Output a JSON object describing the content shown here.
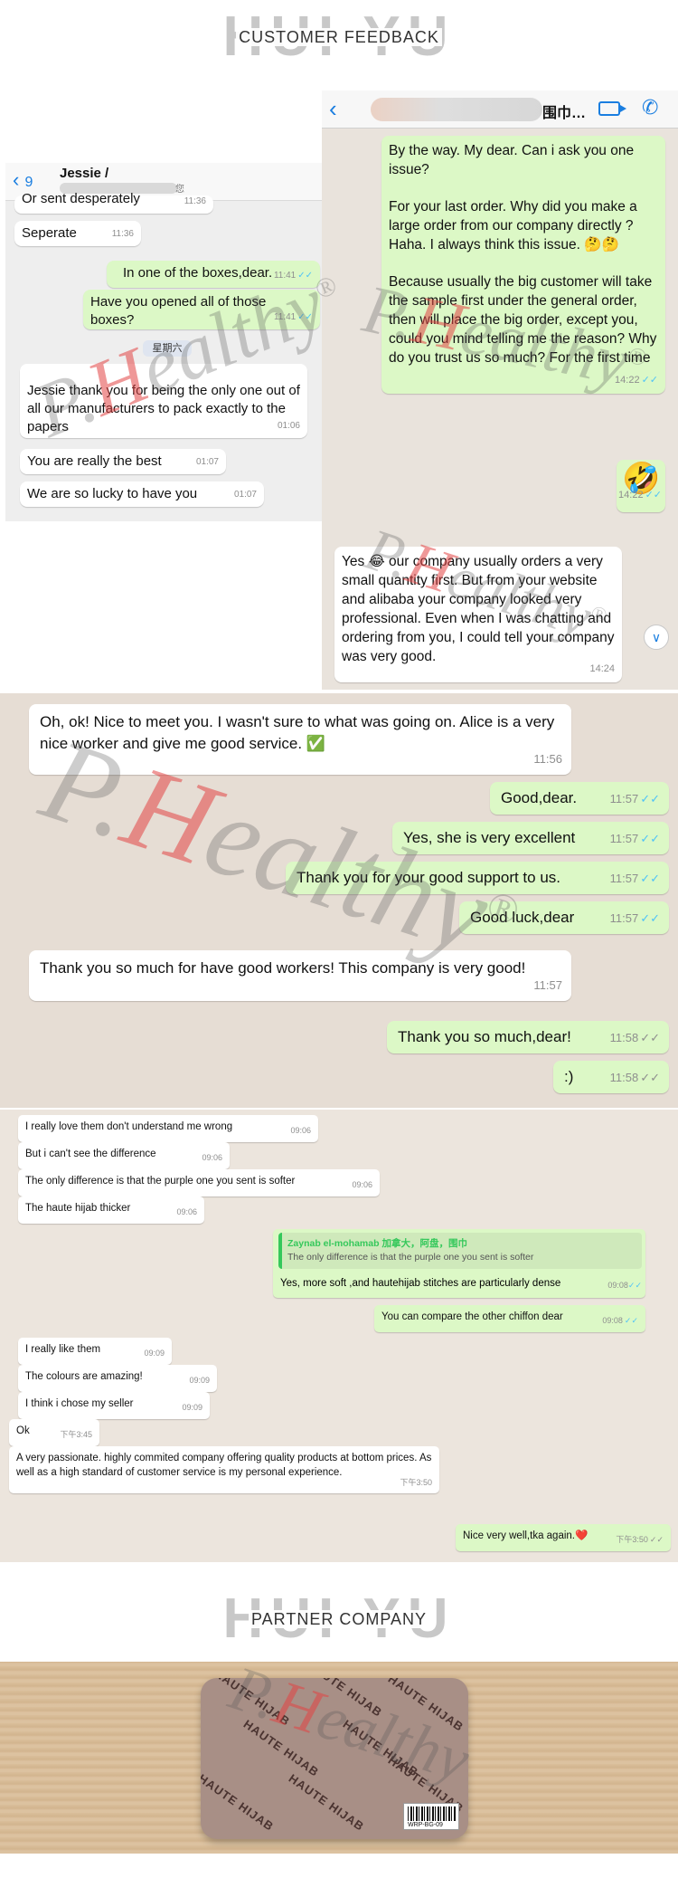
{
  "headings": {
    "feedback": {
      "ghost": "HUI YU",
      "label": "CUSTOMER FEEDBACK"
    },
    "partner": {
      "ghost": "HUI YU",
      "label": "PARTNER COMPANY"
    }
  },
  "watermark": {
    "text_before": "P.",
    "accent": "H",
    "text_after": "ealthy",
    "mark": "®"
  },
  "chat_a": {
    "back_icon": "chevron-left-icon",
    "contact_name": "围巾…",
    "messages": [
      {
        "dir": "out",
        "text": "By the way. My dear.  Can i ask you one issue?",
        "time": ""
      },
      {
        "dir": "out",
        "text": "For your last order.  Why did you make a large order from our company directly ? Haha.  I always think this issue.  🤔🤔",
        "time": ""
      },
      {
        "dir": "out",
        "text": "Because usually the big customer will take the sample first under the general order, then will place the big order, except you, could you mind telling me the reason? Why do you trust us so much? For the first time",
        "time": "14:22",
        "ticks": "✓✓"
      },
      {
        "dir": "out",
        "text": "🤣",
        "time": "14:22",
        "ticks": "✓✓"
      },
      {
        "dir": "in",
        "text": "Yes 😂 our company usually orders a very small quantity first. But from your website and alibaba your company looked very professional. Even when I was chatting and ordering from you, I could tell your company was very good.",
        "time": "14:24"
      }
    ]
  },
  "chat_b": {
    "back_label": "9",
    "title": "Jessie /",
    "subtitle": "您",
    "day_separator": "星期六",
    "messages": [
      {
        "dir": "in",
        "text": "Or sent desperately",
        "time": "11:36"
      },
      {
        "dir": "in",
        "text": "Seperate",
        "time": "11:36"
      },
      {
        "dir": "out",
        "text": "In one of the boxes,dear.",
        "time": "11:41",
        "ticks": "✓✓"
      },
      {
        "dir": "out",
        "text": "Have you opened all of those boxes?",
        "time": "11:41",
        "ticks": "✓✓"
      },
      {
        "dir": "in",
        "text": "Jessie thank you for being the only one out of all our manufacturers to pack exactly to the papers",
        "time": "01:06"
      },
      {
        "dir": "in",
        "text": "You are really the best",
        "time": "01:07"
      },
      {
        "dir": "in",
        "text": "We are so lucky to have you",
        "time": "01:07"
      }
    ]
  },
  "chat_c": {
    "messages": [
      {
        "dir": "in",
        "text": "Oh, ok! Nice to meet you. I wasn't sure to what was going on. Alice is a very nice worker and give me good service. ✅",
        "time": "11:56"
      },
      {
        "dir": "out",
        "text": "Good,dear.",
        "time": "11:57",
        "ticks": "✓✓"
      },
      {
        "dir": "out",
        "text": "Yes, she is very excellent",
        "time": "11:57",
        "ticks": "✓✓"
      },
      {
        "dir": "out",
        "text": "Thank you for your good support to us.",
        "time": "11:57",
        "ticks": "✓✓"
      },
      {
        "dir": "out",
        "text": "Good luck,dear",
        "time": "11:57",
        "ticks": "✓✓"
      },
      {
        "dir": "in",
        "text": "Thank you so much for have good workers! This company is very good!",
        "time": "11:57"
      },
      {
        "dir": "out",
        "text": "Thank you so much,dear!",
        "time": "11:58",
        "ticks": "✓✓"
      },
      {
        "dir": "out",
        "text": ":)",
        "time": "11:58",
        "ticks": "✓✓"
      }
    ]
  },
  "chat_d": {
    "quote": {
      "name": "Zaynab el-mohamab 加拿大，阿盘，围巾",
      "text": "The only difference is that the purple one you sent is softer"
    },
    "messages": [
      {
        "dir": "in",
        "text": "I really love them don't understand me wrong",
        "time": "09:06"
      },
      {
        "dir": "in",
        "text": "But i can't see the difference",
        "time": "09:06"
      },
      {
        "dir": "in",
        "text": "The only difference is that the purple one you sent is softer",
        "time": "09:06"
      },
      {
        "dir": "in",
        "text": "The haute hijab thicker",
        "time": "09:06"
      },
      {
        "dir": "out",
        "text": "Yes, more soft ,and hautehijab stitches are particularly dense",
        "time": "09:08",
        "ticks": "✓✓"
      },
      {
        "dir": "out",
        "text": "You can compare the other chiffon dear",
        "time": "09:08",
        "ticks": "✓✓"
      },
      {
        "dir": "in",
        "text": "I really like them",
        "time": "09:09"
      },
      {
        "dir": "in",
        "text": "The colours are amazing!",
        "time": "09:09"
      },
      {
        "dir": "in",
        "text": "I think i chose my seller",
        "time": "09:09"
      },
      {
        "dir": "in",
        "text": "Ok",
        "time": "下午3:45"
      },
      {
        "dir": "in",
        "text": "A very passionate.  highly commited company offering quality products at bottom prices. As well as a high standard of customer service is my personal experience.",
        "time": "下午3:50"
      },
      {
        "dir": "out",
        "text": "Nice very well,tka again.❤️",
        "time": "下午3:50",
        "ticks": "✓✓"
      }
    ]
  },
  "partner": {
    "print_text": "HAUTE HIJAB",
    "barcode_text": "WRP-BG-09"
  }
}
